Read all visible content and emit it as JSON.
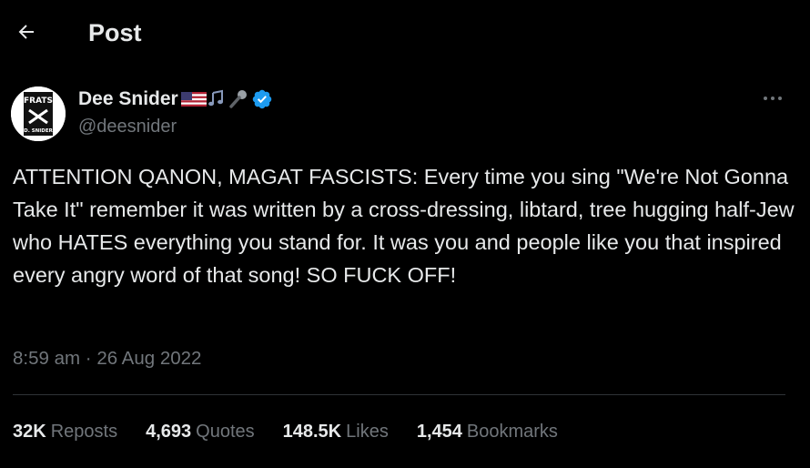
{
  "header": {
    "back_icon": "arrow-left-icon",
    "title": "Post"
  },
  "author": {
    "display_name": "Dee Snider",
    "handle": "@deesnider",
    "name_emojis": [
      "us-flag-emoji",
      "music-notes-emoji",
      "microphone-emoji"
    ],
    "verified_icon": "verified-badge-icon",
    "avatar_text_top": "FRATS",
    "avatar_text_bottom": "D. SNIDER",
    "verified_color": "#1d9bf0"
  },
  "more_icon": "more-dots-icon",
  "tweet": {
    "text": "ATTENTION QANON, MAGAT FASCISTS: Every time you sing \"We're Not Gonna Take It\" remember it was written by a cross-dressing, libtard, tree hugging half-Jew who HATES everything you stand for. It was you and people like you that inspired every angry word of that song! SO FUCK OFF!",
    "time": "8:59 am",
    "separator": "·",
    "date": "26 Aug 2022"
  },
  "stats": [
    {
      "value": "32K",
      "label": "Reposts"
    },
    {
      "value": "4,693",
      "label": "Quotes"
    },
    {
      "value": "148.5K",
      "label": "Likes"
    },
    {
      "value": "1,454",
      "label": "Bookmarks"
    }
  ],
  "colors": {
    "background": "#000000",
    "primary_text": "#e7e9ea",
    "secondary_text": "#71767b",
    "divider": "#2f3336",
    "accent": "#1d9bf0"
  }
}
